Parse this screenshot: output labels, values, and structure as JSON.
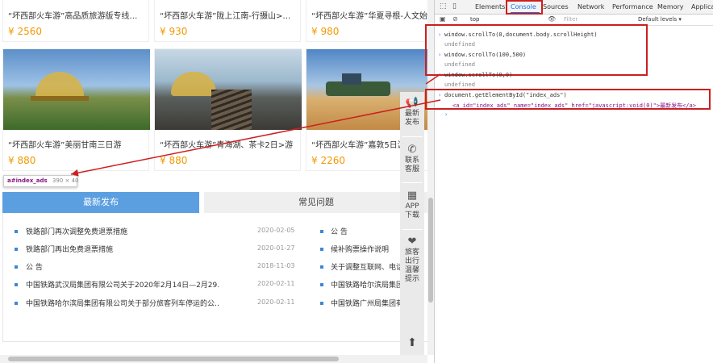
{
  "top_cards": [
    {
      "title": "“坏西部火车游”高品质旅游版专线列车",
      "price": "¥ 2560"
    },
    {
      "title": "“坏西部火车游”陇上江南-行摄山>水陇南…",
      "price": "¥ 930"
    },
    {
      "title": "“坏西部火车游”华夏寻根-人文始祖天…",
      "price": "¥ 980"
    }
  ],
  "cards": [
    {
      "title": "“坏西部火车游”美丽甘南三日游",
      "price": "¥ 880"
    },
    {
      "title": "“坏西部火车游”青海湖、茶卡2日>游",
      "price": "¥ 880"
    },
    {
      "title": "“坏西部火车游”嘉敦5日游",
      "price": "¥ 2260"
    }
  ],
  "tooltip": {
    "selector": "a#index_ads",
    "size": "390 × 40"
  },
  "tabs": {
    "active": "最新发布",
    "inactive": "常见问题"
  },
  "news_left": [
    {
      "text": "铁路部门再次调整免费退票措施",
      "date": "2020-02-05"
    },
    {
      "text": "铁路部门再出免费退票措施",
      "date": "2020-01-27"
    },
    {
      "text": "公 告",
      "date": "2018-11-03"
    },
    {
      "text": "中国铁路武汉局集团有限公司关于2020年2月14日—2月29…",
      "date": "2020-02-11"
    },
    {
      "text": "中国铁路哈尔滨局集团有限公司关于部分旅客列车停运的公…",
      "date": "2020-02-11"
    }
  ],
  "news_right": [
    "公 告",
    "候补购票操作说明",
    "关于调整互联网、电话…",
    "中国铁路哈尔滨局集团…",
    "中国铁路广州局集团有限公…"
  ],
  "sidebar": [
    {
      "l1": "最新",
      "l2": "发布",
      "icon": "megaphone-icon"
    },
    {
      "l1": "联系",
      "l2": "客服",
      "icon": "phone-icon"
    },
    {
      "l1": "APP",
      "l2": "下载",
      "icon": "qrcode-icon"
    },
    {
      "l1": "旅客",
      "l2": "出行",
      "l3": "温馨",
      "l4": "提示",
      "icon": "hand-heart-icon"
    }
  ],
  "devtools": {
    "tabs": [
      "Elements",
      "Console",
      "Sources",
      "Network",
      "Performance",
      "Memory",
      "Applicati"
    ],
    "context": "top",
    "filter_placeholder": "Filter",
    "levels": "Default levels ▾",
    "console": [
      {
        "kind": "in",
        "text": "window.scrollTo(0,document.body.scrollHeight)"
      },
      {
        "kind": "out",
        "text": "undefined"
      },
      {
        "kind": "in",
        "text": "window.scrollTo(100,500)"
      },
      {
        "kind": "out",
        "text": "undefined"
      },
      {
        "kind": "in",
        "text": "window.scrollTo(0,0)"
      },
      {
        "kind": "out",
        "text": "undefined"
      },
      {
        "kind": "in",
        "text": "document.getElementById(\"index_ads\")"
      }
    ],
    "result_html": "<a id=\"index_ads\" name=\"index_ads\" href=\"javascript:void(0)\">最新发布</a>"
  }
}
